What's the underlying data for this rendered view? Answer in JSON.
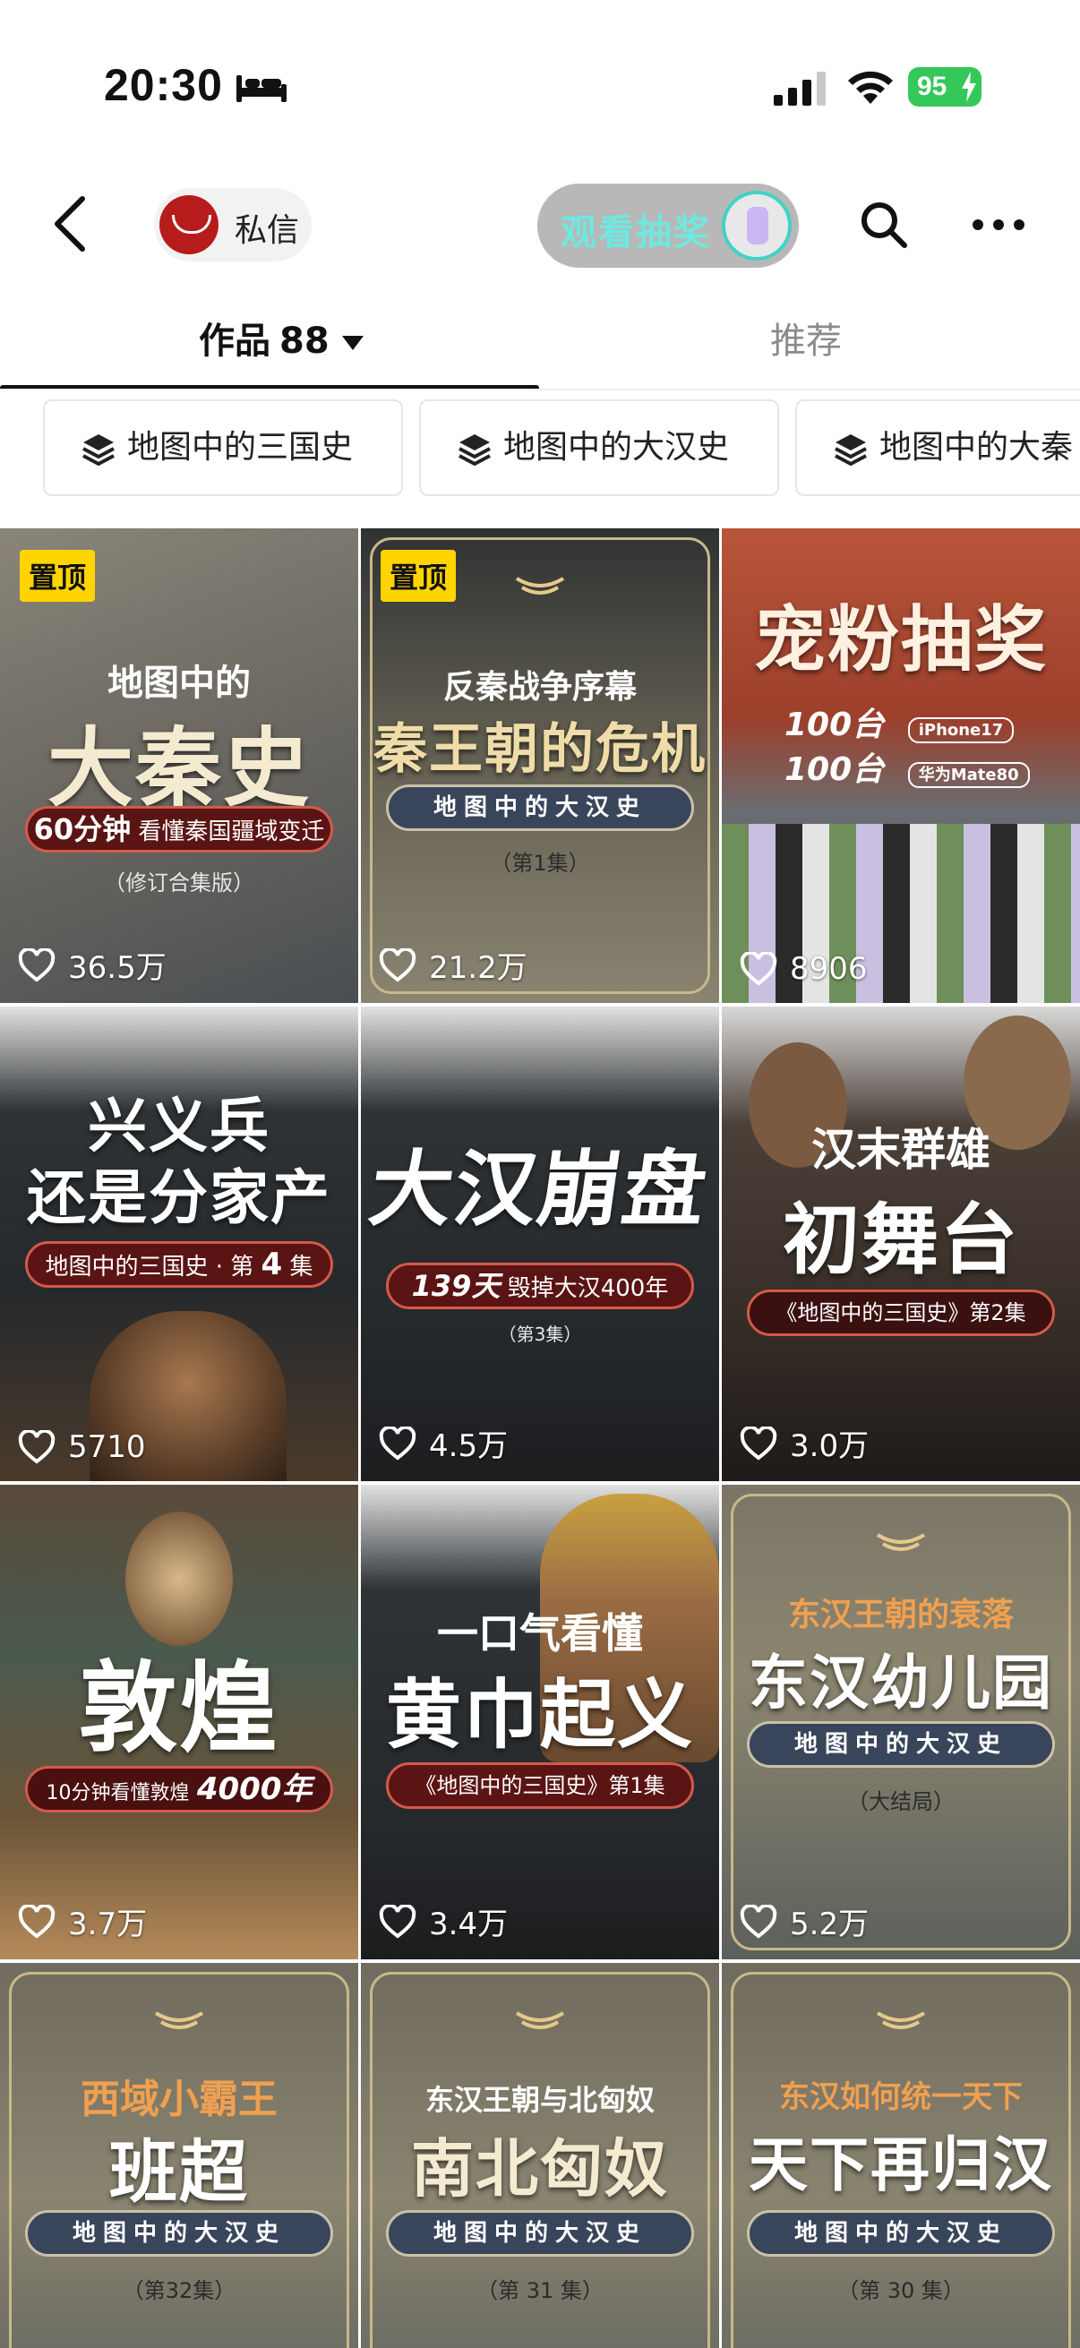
{
  "status": {
    "time": "20:30",
    "battery": "95"
  },
  "nav": {
    "message_label": "私信",
    "lottery_label": "观看抽奖"
  },
  "tabs": {
    "works_label": "作品",
    "works_count": "88",
    "recommend_label": "推荐"
  },
  "collections": [
    "地图中的三国史",
    "地图中的大汉史",
    "地图中的大秦"
  ],
  "pin_label": "置顶",
  "tiles": [
    {
      "pinned": true,
      "kicker": "地图中的",
      "title": "大秦史",
      "pill_strong": "60分钟",
      "pill_text": "看懂秦国疆域变迁",
      "sub": "（修订合集版）",
      "likes": "36.5万"
    },
    {
      "pinned": true,
      "kicker": "反秦战争序幕",
      "title": "秦王朝的危机",
      "pill_text": "地图中的大汉史",
      "sub": "（第1集）",
      "likes": "21.2万"
    },
    {
      "pinned": false,
      "title": "宠粉抽奖",
      "row1_num": "100台",
      "row1_tag": "iPhone17",
      "row2_num": "100台",
      "row2_tag": "华为Mate80",
      "likes": "8906"
    },
    {
      "pinned": false,
      "title_line1": "兴义兵",
      "title_line2": "还是分家产",
      "pill_text": "地图中的三国史 · 第",
      "pill_strong": "4",
      "pill_suffix": "集",
      "likes": "5710"
    },
    {
      "pinned": false,
      "title": "大汉崩盘",
      "pill_strong": "139天",
      "pill_text": "毁掉大汉400年",
      "sub": "（第3集）",
      "likes": "4.5万"
    },
    {
      "pinned": false,
      "kicker": "汉末群雄",
      "title": "初舞台",
      "pill_text": "《地图中的三国史》第2集",
      "likes": "3.0万"
    },
    {
      "pinned": false,
      "title": "敦煌",
      "pill_text": "10分钟看懂敦煌",
      "pill_strong": "4000年",
      "likes": "3.7万"
    },
    {
      "pinned": false,
      "kicker": "一口气看懂",
      "title": "黄巾起义",
      "pill_text": "《地图中的三国史》第1集",
      "likes": "3.4万"
    },
    {
      "pinned": false,
      "kicker": "东汉王朝的衰落",
      "title": "东汉幼儿园",
      "pill_text": "地图中的大汉史",
      "sub": "（大结局）",
      "likes": "5.2万"
    },
    {
      "pinned": false,
      "kicker": "西域小霸王",
      "title": "班超",
      "pill_text": "地图中的大汉史",
      "sub": "（第32集）"
    },
    {
      "pinned": false,
      "kicker": "东汉王朝与北匈奴",
      "title": "南北匈奴",
      "pill_text": "地图中的大汉史",
      "sub": "（第 31 集）"
    },
    {
      "pinned": false,
      "kicker": "东汉如何统一天下",
      "title": "天下再归汉",
      "pill_text": "地图中的大汉史",
      "sub": "（第 30 集）"
    }
  ],
  "colors": {
    "accent_green": "#34c759",
    "lottery_text": "#6ee8e0",
    "pin_yellow": "#ffd400"
  }
}
